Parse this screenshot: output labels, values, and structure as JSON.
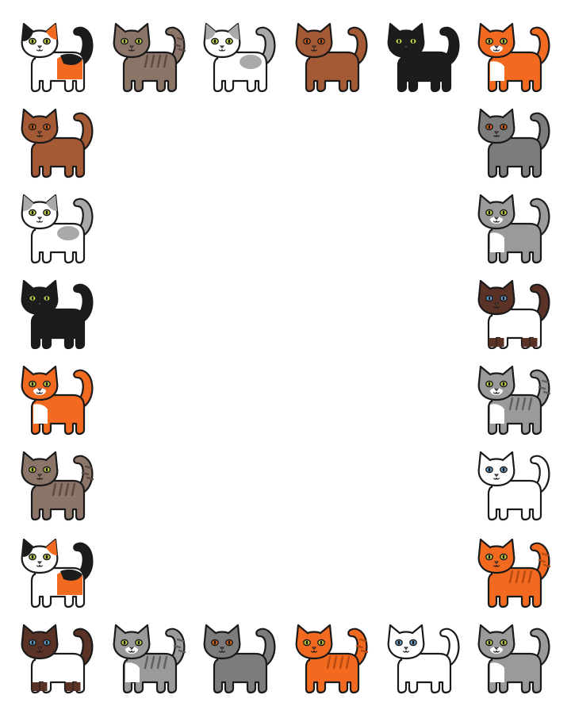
{
  "frame": {
    "background": "#ffffff",
    "cats": [
      {
        "name": "cat-calico",
        "body": "#ffffff",
        "patch1": "#f26a1f",
        "patch2": "#1c1c1c",
        "head": "#ffffff",
        "ear": "#1c1c1c",
        "tail": "#1c1c1c",
        "eyes": "#c9d64a",
        "stripes": false,
        "pattern": "calico-a"
      },
      {
        "name": "cat-brown-tabby",
        "body": "#8b7468",
        "patch1": null,
        "patch2": null,
        "head": "#8b7468",
        "ear": "#8b7468",
        "tail": "#8b7468",
        "eyes": "#c9d64a",
        "stripes": true,
        "stripeColor": "#5b4a42",
        "pattern": "plain"
      },
      {
        "name": "cat-white-grey",
        "body": "#ffffff",
        "patch1": "#a9a9a9",
        "patch2": null,
        "head": "#ffffff",
        "ear": "#a9a9a9",
        "tail": "#a9a9a9",
        "eyes": "#c9d64a",
        "stripes": false,
        "pattern": "bicolor-spot"
      },
      {
        "name": "cat-brown",
        "body": "#a45a34",
        "patch1": null,
        "patch2": null,
        "head": "#a45a34",
        "ear": "#a45a34",
        "tail": "#a45a34",
        "eyes": "#e0641f",
        "stripes": false,
        "pattern": "plain"
      },
      {
        "name": "cat-black",
        "body": "#1c1c1c",
        "patch1": null,
        "patch2": null,
        "head": "#1c1c1c",
        "ear": "#1c1c1c",
        "tail": "#1c1c1c",
        "eyes": "#c9d64a",
        "stripes": false,
        "pattern": "plain"
      },
      {
        "name": "cat-orange-white",
        "body": "#f26a1f",
        "patch1": "#ffffff",
        "patch2": null,
        "head": "#f26a1f",
        "ear": "#f26a1f",
        "tail": "#f26a1f",
        "eyes": "#c9d64a",
        "stripes": false,
        "pattern": "bib"
      },
      {
        "name": "cat-brown-2",
        "body": "#a45a34",
        "patch1": null,
        "patch2": null,
        "head": "#a45a34",
        "ear": "#a45a34",
        "tail": "#a45a34",
        "eyes": "#e0641f",
        "stripes": false,
        "pattern": "plain"
      },
      {
        "name": "cat-grey",
        "body": "#7c7c7c",
        "patch1": null,
        "patch2": null,
        "head": "#7c7c7c",
        "ear": "#7c7c7c",
        "tail": "#7c7c7c",
        "eyes": "#e0641f",
        "stripes": false,
        "pattern": "plain"
      },
      {
        "name": "cat-white-grey-2",
        "body": "#ffffff",
        "patch1": "#a9a9a9",
        "patch2": null,
        "head": "#ffffff",
        "ear": "#a9a9a9",
        "tail": "#a9a9a9",
        "eyes": "#c9d64a",
        "stripes": false,
        "pattern": "bicolor-spot"
      },
      {
        "name": "cat-grey-white",
        "body": "#9a9a9a",
        "patch1": "#ffffff",
        "patch2": null,
        "head": "#9a9a9a",
        "ear": "#9a9a9a",
        "tail": "#9a9a9a",
        "eyes": "#c9d64a",
        "stripes": false,
        "pattern": "bib"
      },
      {
        "name": "cat-black-2",
        "body": "#1c1c1c",
        "patch1": null,
        "patch2": null,
        "head": "#1c1c1c",
        "ear": "#1c1c1c",
        "tail": "#1c1c1c",
        "eyes": "#c9d64a",
        "stripes": false,
        "pattern": "plain"
      },
      {
        "name": "cat-siamese",
        "body": "#ffffff",
        "patch1": "#5a3226",
        "patch2": null,
        "head": "#5a3226",
        "ear": "#5a3226",
        "tail": "#5a3226",
        "eyes": "#6aa7d6",
        "stripes": false,
        "pattern": "siamese"
      },
      {
        "name": "cat-orange-white-2",
        "body": "#f26a1f",
        "patch1": "#ffffff",
        "patch2": null,
        "head": "#f26a1f",
        "ear": "#f26a1f",
        "tail": "#f26a1f",
        "eyes": "#c9d64a",
        "stripes": false,
        "pattern": "bib"
      },
      {
        "name": "cat-grey-tabby-white",
        "body": "#9a9a9a",
        "patch1": "#ffffff",
        "patch2": null,
        "head": "#9a9a9a",
        "ear": "#9a9a9a",
        "tail": "#9a9a9a",
        "eyes": "#c9d64a",
        "stripes": true,
        "stripeColor": "#5e5e5e",
        "pattern": "bib"
      },
      {
        "name": "cat-brown-tabby-2",
        "body": "#8b7468",
        "patch1": null,
        "patch2": null,
        "head": "#8b7468",
        "ear": "#8b7468",
        "tail": "#8b7468",
        "eyes": "#c9d64a",
        "stripes": true,
        "stripeColor": "#5b4a42",
        "pattern": "plain"
      },
      {
        "name": "cat-white",
        "body": "#ffffff",
        "patch1": null,
        "patch2": null,
        "head": "#ffffff",
        "ear": "#ffffff",
        "tail": "#ffffff",
        "eyes": "#6aa7d6",
        "stripes": false,
        "pattern": "plain"
      },
      {
        "name": "cat-calico-2",
        "body": "#ffffff",
        "patch1": "#f26a1f",
        "patch2": "#1c1c1c",
        "head": "#ffffff",
        "ear": "#1c1c1c",
        "tail": "#1c1c1c",
        "eyes": "#c9d64a",
        "stripes": false,
        "pattern": "calico-a"
      },
      {
        "name": "cat-orange-tabby",
        "body": "#f26a1f",
        "patch1": null,
        "patch2": null,
        "head": "#f26a1f",
        "ear": "#f26a1f",
        "tail": "#f26a1f",
        "eyes": "#c9d64a",
        "stripes": true,
        "stripeColor": "#b84a14",
        "pattern": "plain"
      },
      {
        "name": "cat-siamese-2",
        "body": "#ffffff",
        "patch1": "#5a3226",
        "patch2": null,
        "head": "#5a3226",
        "ear": "#5a3226",
        "tail": "#5a3226",
        "eyes": "#6aa7d6",
        "stripes": false,
        "pattern": "siamese"
      },
      {
        "name": "cat-grey-tabby-white-2",
        "body": "#9a9a9a",
        "patch1": "#ffffff",
        "patch2": null,
        "head": "#9a9a9a",
        "ear": "#9a9a9a",
        "tail": "#9a9a9a",
        "eyes": "#c9d64a",
        "stripes": true,
        "stripeColor": "#5e5e5e",
        "pattern": "bib"
      },
      {
        "name": "cat-grey-2",
        "body": "#7c7c7c",
        "patch1": null,
        "patch2": null,
        "head": "#7c7c7c",
        "ear": "#7c7c7c",
        "tail": "#7c7c7c",
        "eyes": "#e0641f",
        "stripes": false,
        "pattern": "plain"
      },
      {
        "name": "cat-orange-tabby-2",
        "body": "#f26a1f",
        "patch1": null,
        "patch2": null,
        "head": "#f26a1f",
        "ear": "#f26a1f",
        "tail": "#f26a1f",
        "eyes": "#c9d64a",
        "stripes": true,
        "stripeColor": "#b84a14",
        "pattern": "plain"
      },
      {
        "name": "cat-white-2",
        "body": "#ffffff",
        "patch1": null,
        "patch2": null,
        "head": "#ffffff",
        "ear": "#ffffff",
        "tail": "#ffffff",
        "eyes": "#6aa7d6",
        "stripes": false,
        "pattern": "plain"
      },
      {
        "name": "cat-grey-white-2",
        "body": "#9a9a9a",
        "patch1": "#ffffff",
        "patch2": null,
        "head": "#9a9a9a",
        "ear": "#9a9a9a",
        "tail": "#9a9a9a",
        "eyes": "#c9d64a",
        "stripes": false,
        "pattern": "bib"
      }
    ]
  }
}
